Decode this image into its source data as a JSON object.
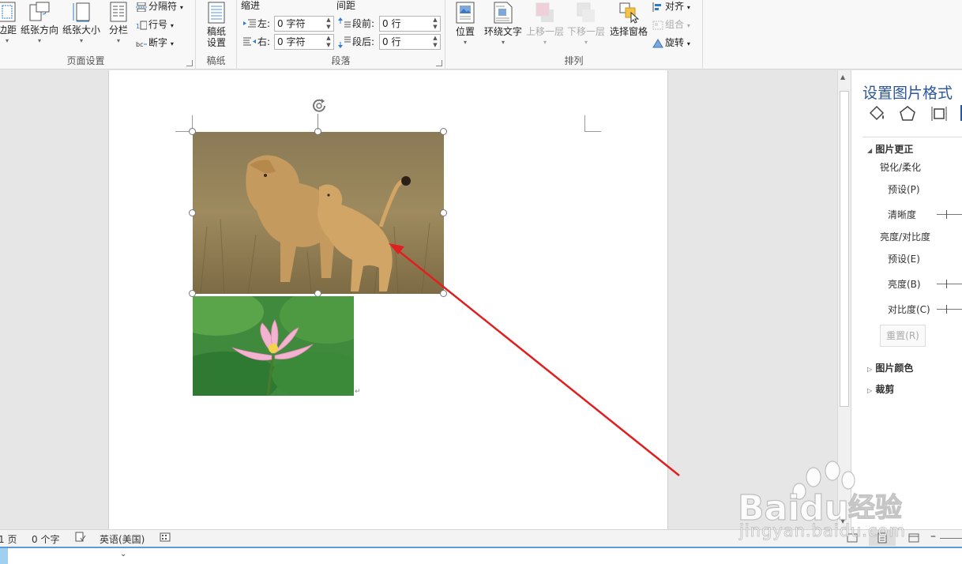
{
  "ribbon": {
    "page_setup": {
      "margins_label": "边距",
      "orientation_label": "纸张方向",
      "size_label": "纸张大小",
      "columns_label": "分栏",
      "breaks_label": "分隔符",
      "line_numbers_label": "行号",
      "hyphenation_label": "断字",
      "group_label": "页面设置"
    },
    "manuscript": {
      "button_label": "稿纸\n设置",
      "group_label": "稿纸"
    },
    "paragraph": {
      "indent_header": "缩进",
      "spacing_header": "间距",
      "indent_left_label": "左:",
      "indent_left_value": "0 字符",
      "indent_right_label": "右:",
      "indent_right_value": "0 字符",
      "spacing_before_label": "段前:",
      "spacing_before_value": "0 行",
      "spacing_after_label": "段后:",
      "spacing_after_value": "0 行",
      "group_label": "段落"
    },
    "arrange": {
      "position_label": "位置",
      "wrap_text_label": "环绕文字",
      "bring_forward_label": "上移一层",
      "send_backward_label": "下移一层",
      "selection_pane_label": "选择窗格",
      "align_label": "对齐",
      "group_label_btn": "组合",
      "rotate_label": "旋转",
      "group_label": "排列"
    }
  },
  "pane": {
    "title": "设置图片格式",
    "section_corrections": "图片更正",
    "sharpen_soften": "锐化/柔化",
    "preset_p": "预设(P)",
    "sharpness": "清晰度",
    "brightness_contrast": "亮度/对比度",
    "preset_e": "预设(E)",
    "brightness": "亮度(B)",
    "contrast": "对比度(C)",
    "reset": "重置(R)",
    "section_color": "图片颜色",
    "section_crop": "裁剪"
  },
  "status": {
    "page": "1 页",
    "words": "0 个字",
    "language": "英语(美国)"
  },
  "watermark": {
    "brand": "Bai",
    "brand2": "du",
    "brand_cn": "经验",
    "url": "jingyan.baidu.com"
  },
  "colors": {
    "accent": "#2b579a",
    "arrow": "#e02020"
  }
}
